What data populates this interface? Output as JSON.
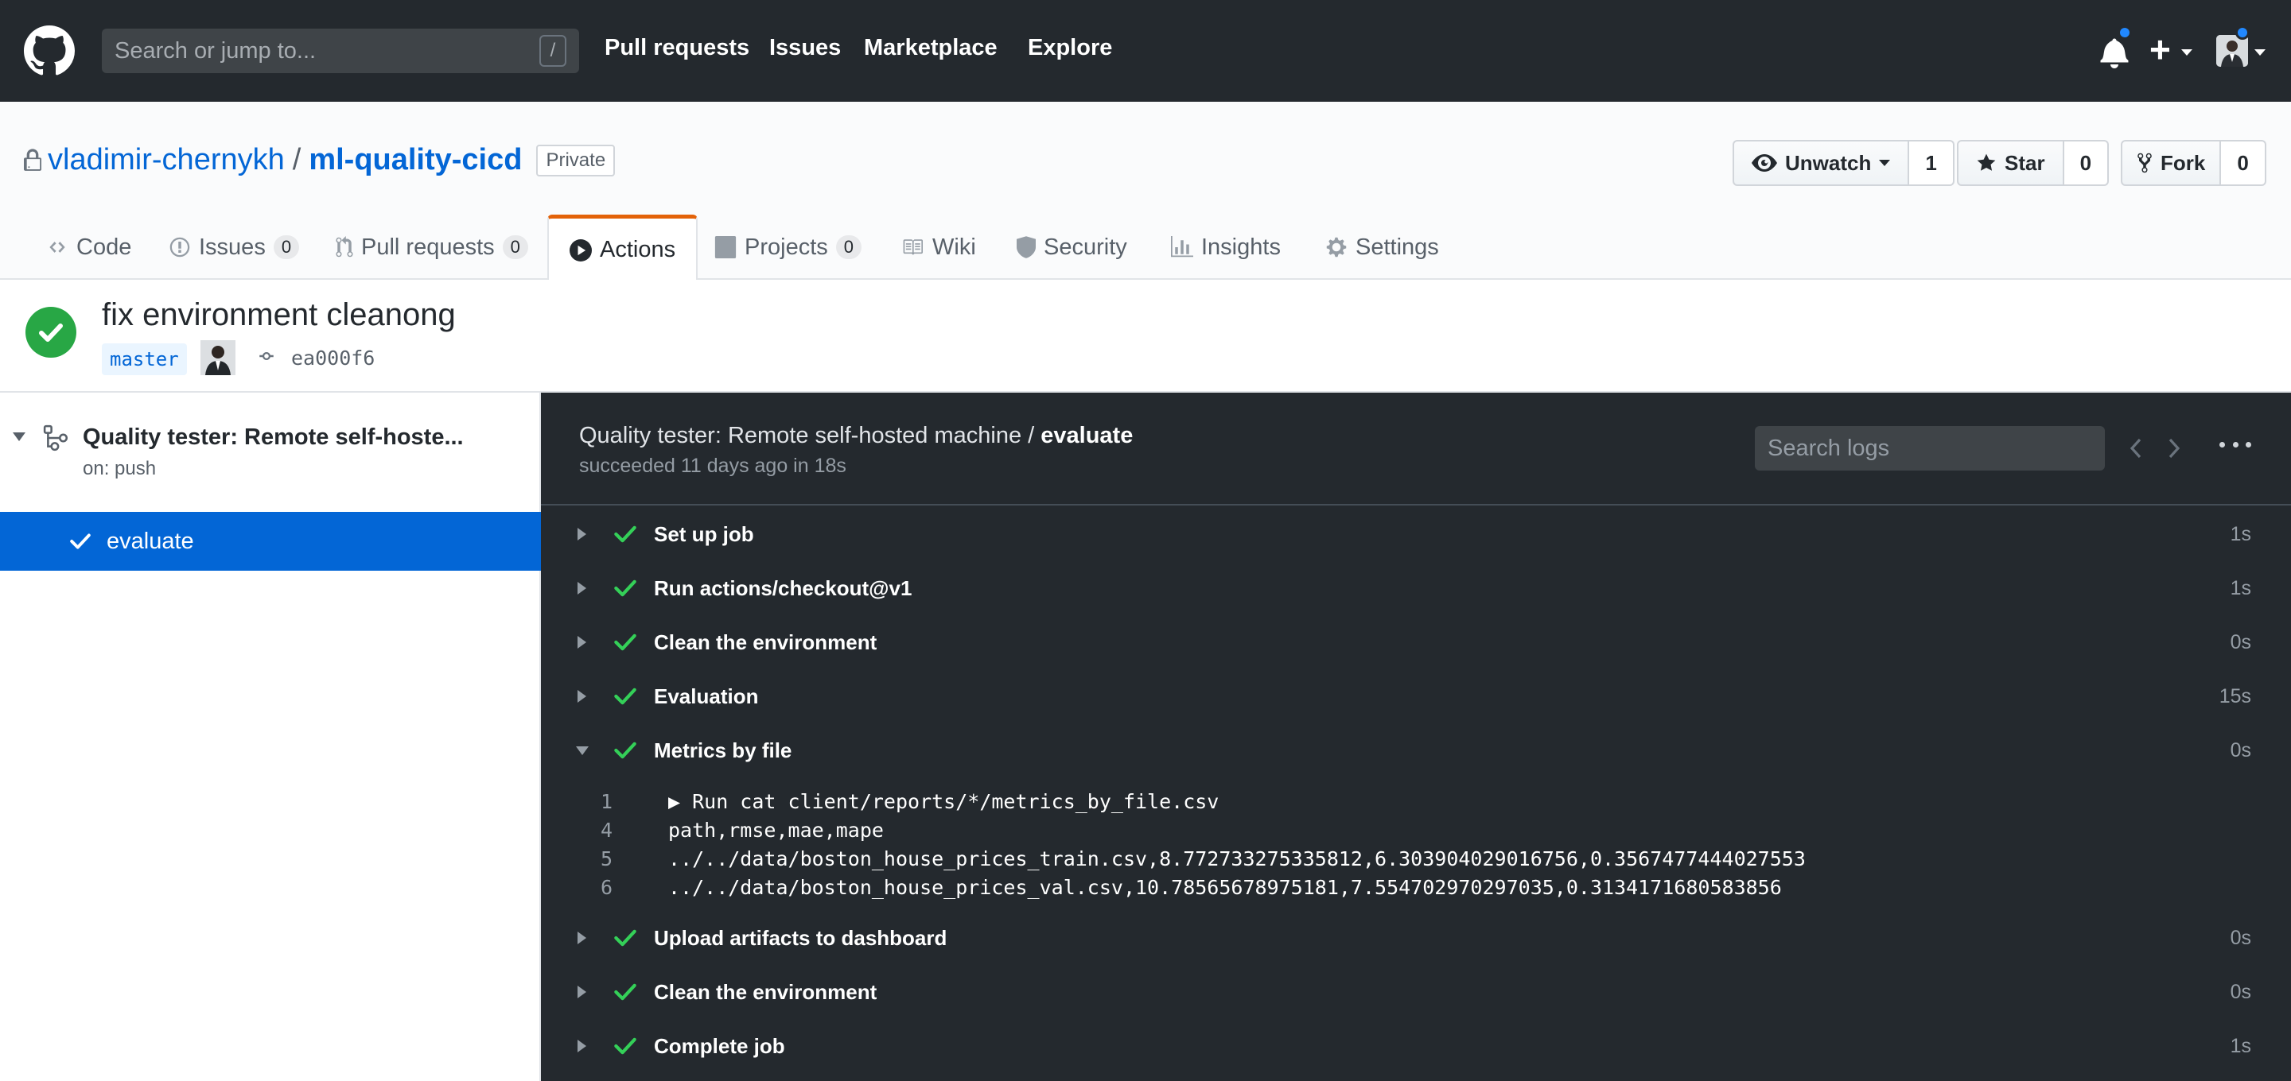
{
  "header": {
    "search_placeholder": "Search or jump to...",
    "search_key": "/",
    "nav": [
      "Pull requests",
      "Issues",
      "Marketplace",
      "Explore"
    ],
    "plus": "+"
  },
  "repo": {
    "owner": "vladimir-chernykh",
    "separator": "/",
    "name": "ml-quality-cicd",
    "visibility": "Private",
    "watch_label": "Unwatch",
    "watch_count": "1",
    "star_label": "Star",
    "star_count": "0",
    "fork_label": "Fork",
    "fork_count": "0"
  },
  "tabs": [
    {
      "label": "Code"
    },
    {
      "label": "Issues",
      "count": "0"
    },
    {
      "label": "Pull requests",
      "count": "0"
    },
    {
      "label": "Actions"
    },
    {
      "label": "Projects",
      "count": "0"
    },
    {
      "label": "Wiki"
    },
    {
      "label": "Security"
    },
    {
      "label": "Insights"
    },
    {
      "label": "Settings"
    }
  ],
  "commit": {
    "title": "fix environment cleanong",
    "branch": "master",
    "sha": "ea000f6"
  },
  "sidebar": {
    "workflow": "Quality tester: Remote self-hoste...",
    "trigger": "on: push",
    "job": "evaluate"
  },
  "log": {
    "title_prefix": "Quality tester: Remote self-hosted machine / ",
    "title_job": "evaluate",
    "status": "succeeded 11 days ago in 18s",
    "search_placeholder": "Search logs",
    "steps": [
      {
        "name": "Set up job",
        "duration": "1s"
      },
      {
        "name": "Run actions/checkout@v1",
        "duration": "1s"
      },
      {
        "name": "Clean the environment",
        "duration": "0s"
      },
      {
        "name": "Evaluation",
        "duration": "15s"
      },
      {
        "name": "Metrics by file",
        "duration": "0s"
      },
      {
        "name": "Upload artifacts to dashboard",
        "duration": "0s"
      },
      {
        "name": "Clean the environment",
        "duration": "0s"
      },
      {
        "name": "Complete job",
        "duration": "1s"
      }
    ],
    "lines": [
      {
        "num": "1",
        "text": "▶ Run cat client/reports/*/metrics_by_file.csv"
      },
      {
        "num": "4",
        "text": "path,rmse,mae,mape"
      },
      {
        "num": "5",
        "text": "../../data/boston_house_prices_train.csv,8.772733275335812,6.303904029016756,0.3567477444027553"
      },
      {
        "num": "6",
        "text": "../../data/boston_house_prices_val.csv,10.78565678975181,7.554702970297035,0.3134171680583856"
      }
    ]
  }
}
